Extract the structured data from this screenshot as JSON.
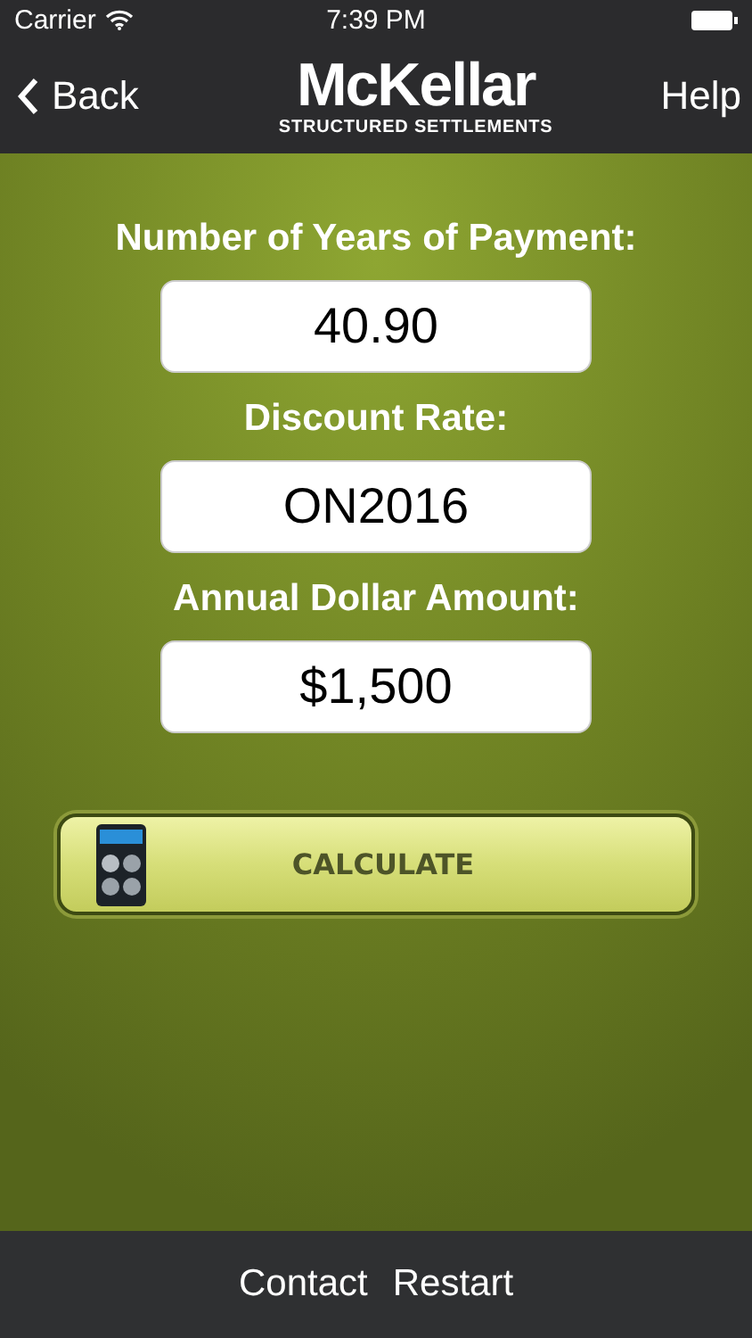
{
  "status_bar": {
    "carrier": "Carrier",
    "time": "7:39 PM"
  },
  "nav": {
    "back": "Back",
    "logo": "McKellar",
    "logo_subtitle": "STRUCTURED SETTLEMENTS",
    "help": "Help"
  },
  "fields": [
    {
      "label": "Number of Years of Payment:",
      "value": "40.90"
    },
    {
      "label": "Discount Rate:",
      "value": "ON2016"
    },
    {
      "label": "Annual Dollar Amount:",
      "value": "$1,500"
    }
  ],
  "calculate_button": "CALCULATE",
  "footer": [
    "Contact",
    "Restart"
  ]
}
